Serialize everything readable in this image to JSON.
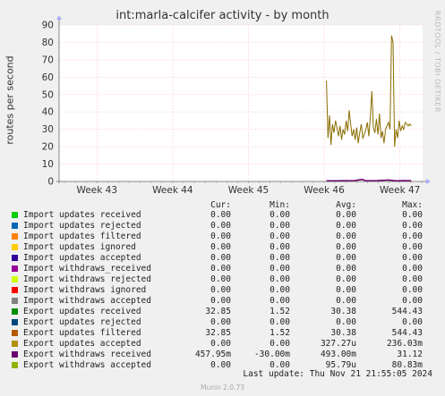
{
  "title": "int:marla-calcifer activity - by month",
  "watermark": "RRDTOOL / TOBI OETIKER",
  "footer": {
    "last_update": "Last update: Thu Nov 21 21:55:05 2024",
    "version": "Munin 2.0.73"
  },
  "legend_headers": [
    "Cur:",
    "Min:",
    "Avg:",
    "Max:"
  ],
  "legend": [
    {
      "name": "Import updates received",
      "color": "#00cc00",
      "cur": "0.00",
      "min": "0.00",
      "avg": "0.00",
      "max": "0.00"
    },
    {
      "name": "Import updates rejected",
      "color": "#0066b3",
      "cur": "0.00",
      "min": "0.00",
      "avg": "0.00",
      "max": "0.00"
    },
    {
      "name": "Import updates filtered",
      "color": "#ff8000",
      "cur": "0.00",
      "min": "0.00",
      "avg": "0.00",
      "max": "0.00"
    },
    {
      "name": "Import updates ignored",
      "color": "#ffcc00",
      "cur": "0.00",
      "min": "0.00",
      "avg": "0.00",
      "max": "0.00"
    },
    {
      "name": "Import updates accepted",
      "color": "#330099",
      "cur": "0.00",
      "min": "0.00",
      "avg": "0.00",
      "max": "0.00"
    },
    {
      "name": "Import withdraws_received",
      "color": "#990099",
      "cur": "0.00",
      "min": "0.00",
      "avg": "0.00",
      "max": "0.00"
    },
    {
      "name": "Import withdraws rejected",
      "color": "#ccff00",
      "cur": "0.00",
      "min": "0.00",
      "avg": "0.00",
      "max": "0.00"
    },
    {
      "name": "Import withdraws ignored",
      "color": "#ff0000",
      "cur": "0.00",
      "min": "0.00",
      "avg": "0.00",
      "max": "0.00"
    },
    {
      "name": "Import withdraws accepted",
      "color": "#808080",
      "cur": "0.00",
      "min": "0.00",
      "avg": "0.00",
      "max": "0.00"
    },
    {
      "name": "Export updates received",
      "color": "#008f00",
      "cur": "32.85",
      "min": "1.52",
      "avg": "30.38",
      "max": "544.43"
    },
    {
      "name": "Export updates rejected",
      "color": "#00487d",
      "cur": "0.00",
      "min": "0.00",
      "avg": "0.00",
      "max": "0.00"
    },
    {
      "name": "Export updates filtered",
      "color": "#b35a00",
      "cur": "32.85",
      "min": "1.52",
      "avg": "30.38",
      "max": "544.43"
    },
    {
      "name": "Export updates accepted",
      "color": "#b38f00",
      "cur": "0.00",
      "min": "0.00",
      "avg": "327.27u",
      "max": "236.03m"
    },
    {
      "name": "Export withdraws received",
      "color": "#6b006b",
      "cur": "457.95m",
      "min": "-30.00m",
      "avg": "493.00m",
      "max": "31.12"
    },
    {
      "name": "Export withdraws accepted",
      "color": "#8fb300",
      "cur": "0.00",
      "min": "0.00",
      "avg": "95.79u",
      "max": "80.83m"
    }
  ],
  "chart_data": {
    "type": "line",
    "title": "int:marla-calcifer activity - by month",
    "ylabel": "routes per second",
    "xlabel": "",
    "ylim": [
      0,
      90
    ],
    "yticks": [
      0,
      10,
      20,
      30,
      40,
      50,
      60,
      70,
      80,
      90
    ],
    "xlim_weeks": [
      42.5,
      47.3
    ],
    "xticks": [
      {
        "label": "Week 43",
        "at": 43
      },
      {
        "label": "Week 44",
        "at": 44
      },
      {
        "label": "Week 45",
        "at": 45
      },
      {
        "label": "Week 46",
        "at": 46
      },
      {
        "label": "Week 47",
        "at": 47
      }
    ],
    "grid": true,
    "series": [
      {
        "name": "Export updates accepted",
        "color": "#8a6d00",
        "x": [
          46.03,
          46.05,
          46.07,
          46.09,
          46.11,
          46.13,
          46.15,
          46.17,
          46.19,
          46.21,
          46.23,
          46.25,
          46.27,
          46.29,
          46.31,
          46.33,
          46.35,
          46.37,
          46.39,
          46.41,
          46.43,
          46.45,
          46.47,
          46.49,
          46.51,
          46.53,
          46.55,
          46.57,
          46.59,
          46.61,
          46.63,
          46.65,
          46.67,
          46.69,
          46.71,
          46.73,
          46.75,
          46.77,
          46.79,
          46.81,
          46.83,
          46.85,
          46.87,
          46.89,
          46.91,
          46.93,
          46.95,
          46.97,
          46.99,
          47.01,
          47.03,
          47.05,
          47.07,
          47.09,
          47.11,
          47.13,
          47.15
        ],
        "y": [
          58,
          25,
          38,
          21,
          33,
          28,
          35,
          31,
          26,
          32,
          24,
          30,
          27,
          35,
          29,
          41,
          33,
          26,
          30,
          24,
          31,
          22,
          28,
          33,
          25,
          27,
          30,
          34,
          26,
          37,
          52,
          31,
          28,
          36,
          27,
          39,
          25,
          29,
          22,
          30,
          32,
          34,
          30,
          84,
          80,
          20,
          30,
          25,
          35,
          29,
          32,
          30,
          34,
          33,
          32,
          33,
          32
        ]
      },
      {
        "name": "Export withdraws received",
        "color": "#6b006b",
        "x": [
          46.03,
          46.2,
          46.4,
          46.5,
          46.55,
          46.7,
          46.85,
          46.95,
          47.05,
          47.15
        ],
        "y": [
          0.4,
          0.4,
          0.5,
          1.2,
          0.4,
          0.5,
          0.8,
          0.4,
          0.5,
          0.46
        ]
      }
    ]
  }
}
